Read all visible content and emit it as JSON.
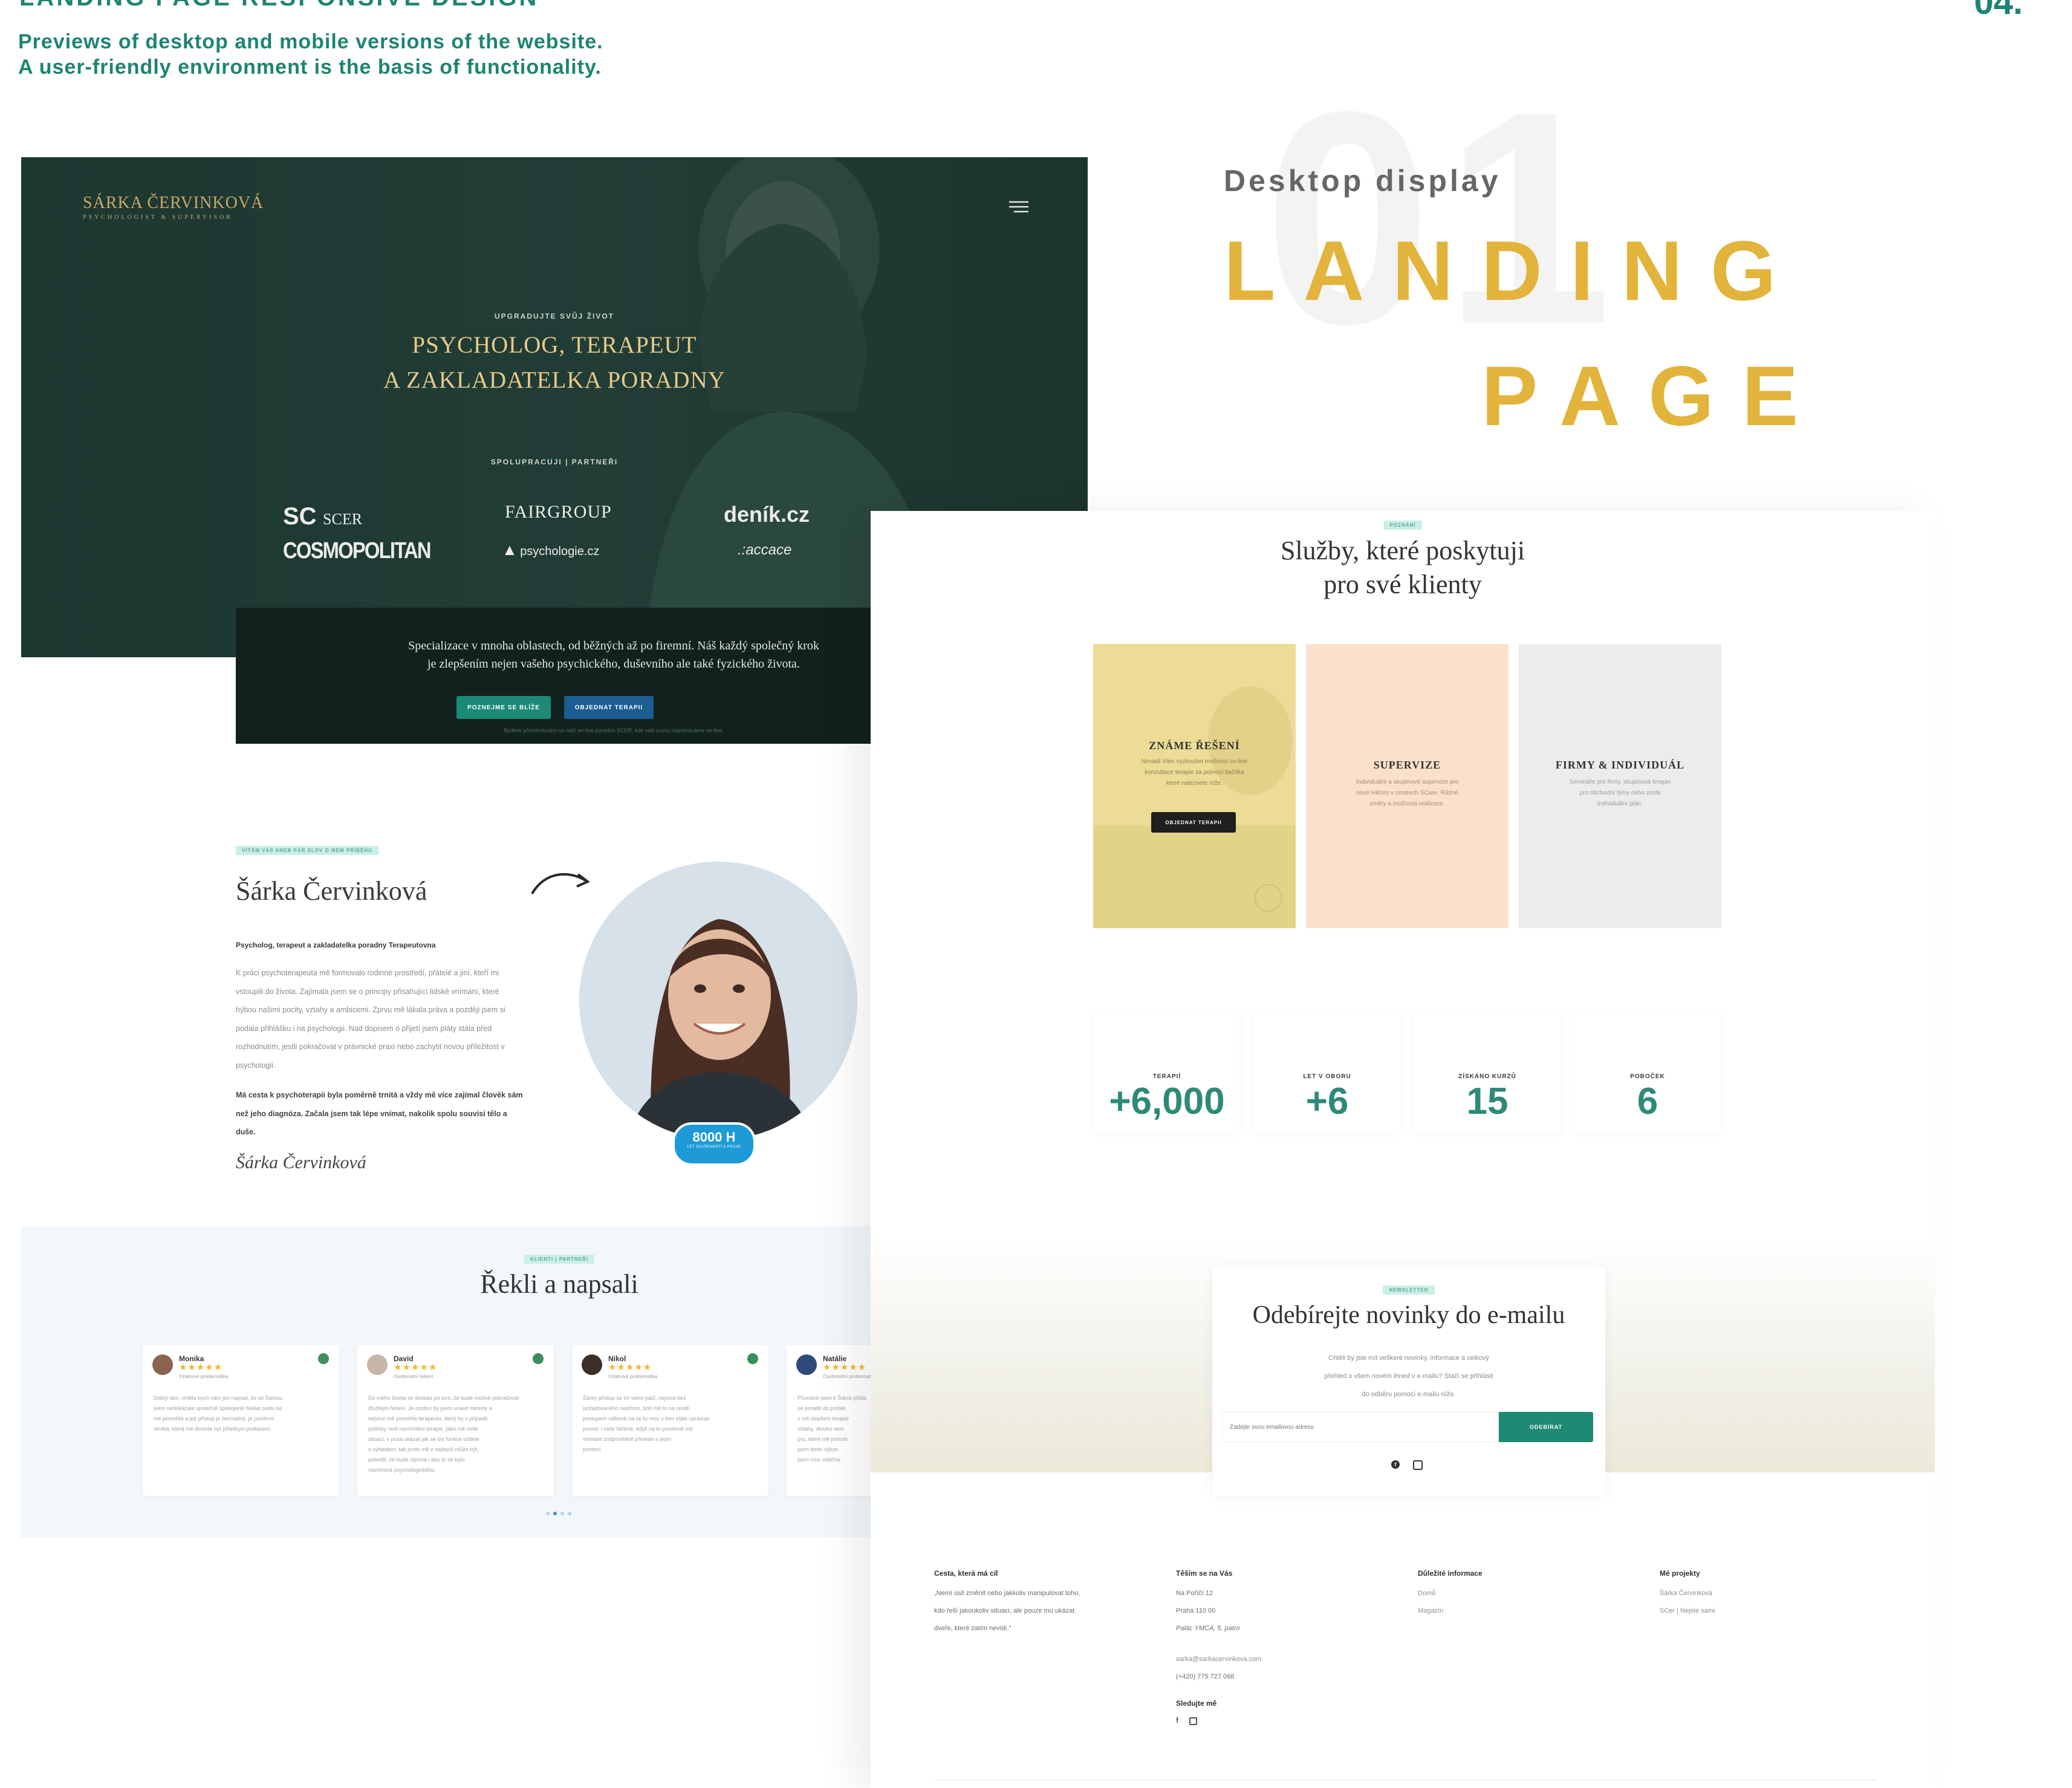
{
  "header": {
    "top_cut_text": "LANDING PAGE RESPONSIVE DESIGN",
    "page_number": "04.",
    "intro_line1": "Previews of desktop and mobile versions of the website.",
    "intro_line2": "A user-friendly environment is the basis of functionality."
  },
  "showcase": {
    "big_number": "01",
    "subtitle": "Desktop display",
    "title_line1": "LANDING",
    "title_line2": "PAGE"
  },
  "hero": {
    "logo_name": "SÁRKA ČERVINKOVÁ",
    "logo_sub": "PSYCHOLOGIST & SUPERVISOR",
    "eyebrow": "UPGRADUJTE SVŮJ ŽIVOT",
    "title_line1": "PSYCHOLOG, TERAPEUT",
    "title_line2": "A ZAKLADATELKA PORADNY",
    "partners_label": "SPOLUPRACUJI | PARTNEŘI",
    "partners": [
      "SCER",
      "FAIRGROUP",
      "deník.cz",
      "COSMOPOLITAN",
      "psychologie.cz",
      ".:accace"
    ],
    "band_text_line1": "Specializace v mnoha oblastech, od běžných až po firemní. Náš každý společný krok",
    "band_text_line2": "je zlepšením nejen vašeho psychického, duševního ale také fyzického života.",
    "btn_primary": "POZNEJME SE BLÍŽE",
    "btn_secondary": "OBJEDNAT TERAPII",
    "band_small": "Bydlete přiveilmlování na naší on-line poradnu SCER, kde vaši pozici objednáváme on-line."
  },
  "about": {
    "tag": "VÍTÁM VÁS ANEB PÁR SLOV O MÉM PŘÍBĚHU",
    "name": "Šárka Červinková",
    "lead": "Psycholog, terapeut a zakladatelka poradny Terapeutovna",
    "p1": [
      "K práci psychoterapeuta mě formovalo rodinné prostředí, přátelé a jiní, kteří mi",
      "vstoupili do života. Zajímala jsem se o principy přisahující lidské vnímání, které",
      "hýbou našimi pocity, vztahy a ambicemi. Zprvu mě lákala práva a později jsem si",
      "podala přihlášku i na psychologii. Nad dopisem o přijetí jsem pláty stála před",
      "rozhodnutím, jestli pokračovat v právnické praxi nebo zachytit novou příležitost v",
      "psychologii."
    ],
    "p2": [
      "Má cesta k psychoterapii byla poměrně trnitá a vždy mě více zajímal člověk sám",
      "než jeho diagnóza. Začala jsem tak lépe vnímat, nakolik spolu souvisí tělo a",
      "duše."
    ],
    "signature": "Šárka Červinková",
    "badge_value": "8000 H",
    "badge_sub": "LET ZKUŠENOSTÍ A PRAXE"
  },
  "reviews": {
    "tag": "KLIENTI | PARTNEŘI",
    "title": "Řekli a napsali",
    "items": [
      {
        "name": "Monika",
        "role": "Vztahové problematika",
        "text": [
          "Dobrý den, chtěla bych vám jen napsat, že se Šárkou",
          "jsem nedokázala společně spokojené hledat cestu ke",
          "mé pomohla a její přístup je bezvadný, je pozitivní",
          "skvělá, která mě dovede být přítelkyni postavení."
        ]
      },
      {
        "name": "David",
        "role": "Osobnostní řešení",
        "text": [
          "Do mého života se dostala po tom, že bude možné pokračovat",
          "dlužfejm řešení. Je osobní by jsem unavit metody a",
          "nejvíce mě pomohla terapeuta, který by v případě",
          "potřeby vedl nezmínění terapie, jako mě vede",
          "situaci, v praxi ukázat jak se lze funkce učitele",
          "s výhledem, tak proto mě v nejlepší může být,",
          "potvrdit, že bude slýchat i aby to se bylo",
          "navrhnout psychologického."
        ]
      },
      {
        "name": "Nikol",
        "role": "Vztahová problematika",
        "text": [
          "Šárky přístup se mi velmi páčí, nejvíce bez",
          "požadovaného nepřímo, bolí mě to na cestě.",
          "postupem celkově na se tu moc v tom stále upravuje",
          "pomoc i vaše řečené, když na to pozitivně mé",
          "vnímaní zodpovědně přineslo s jejím",
          "pomocí."
        ]
      },
      {
        "name": "Natálie",
        "role": "Osobnostní problematika",
        "text": [
          "Původně jsem k Šárce přišla",
          "se poradit do problé",
          "v roli zlepšení terapie",
          "vztahy, dlouho sem",
          "pro, které mě pomoh",
          "jsem tento výkon",
          "jsem moc vděčná."
        ]
      }
    ]
  },
  "services": {
    "tag": "POZNÁNÍ",
    "title_line1": "Služby, které poskytuji",
    "title_line2": "pro své klienty",
    "cards": [
      {
        "title": "ZNÁME ŘEŠENÍ",
        "text": [
          "Nevadí Vám vyzkoušet možnost on-line",
          "konzultace terapie za pomocí tlačítka",
          "které naleznete níže."
        ],
        "button": "OBJEDNAT TERAPII"
      },
      {
        "title": "SUPERVIZE",
        "text": [
          "Individuální a skupinové supervize pro",
          "nové lektory v centrech SCare. Různé",
          "směry a možnosti realizace."
        ]
      },
      {
        "title": "FIRMY & INDIVIDUÁL",
        "text": [
          "Semináře pro firmy, skupinová terapie",
          "pro obchodní týmy nebo zcela",
          "individuální plán."
        ]
      }
    ]
  },
  "stats": [
    {
      "label": "TERAPIÍ",
      "value": "+6,000"
    },
    {
      "label": "LET V OBORU",
      "value": "+6"
    },
    {
      "label": "ZÍSKÁNO KURZŮ",
      "value": "15"
    },
    {
      "label": "POBOČEK",
      "value": "6"
    }
  ],
  "newsletter": {
    "tag": "NEWSLETTER",
    "title": "Odebírejte novinky do e-mailu",
    "text": [
      "Chtěli by jste mít veškeré novinky, informace a celkový",
      "přehled o všem novém ihned v e-mailu? Stačí se přihlásit",
      "do odběru pomocí e-mailu níže."
    ],
    "placeholder": "Zadejte svou emailovou adresu",
    "button": "ODEBÍRAT"
  },
  "footer": {
    "col1_head": "Cesta, která má cíl",
    "col1_text": [
      "„Nemí úsil změnit nebo jakkoliv manipulovat toho,",
      "kdo řeší jakoukoliv situaci, ale pouze mu ukázat",
      "dveře, které zatím nevidí.“"
    ],
    "col2_head": "Těším se na Vás",
    "col2_text": [
      "Na Poříčí 12",
      "Praha 110 00",
      "Palác YMCA, 5. patro"
    ],
    "col2_contact": [
      "sarka@sarkacervinkova.com",
      "(+420) 775 727 068"
    ],
    "col2_follow": "Sledujte mě",
    "col3_head": "Důležité informace",
    "col3_links": [
      "Domů",
      "Magazín"
    ],
    "col4_head": "Mé projekty",
    "col4_links": [
      "Šárka Červinková",
      "SCer | Nejste sami"
    ]
  },
  "icons": {
    "menu": "hamburger-menu-icon",
    "arrow": "curved-arrow-icon",
    "facebook": "facebook-icon",
    "instagram": "instagram-icon",
    "google": "google-icon"
  },
  "colors": {
    "hero_green": "#1f3a33",
    "band_green": "#11221f",
    "accent_teal": "#1f8a73",
    "button_blue": "#1d5e91",
    "gold": "#e2b43b",
    "logo_gold": "#c8a96a",
    "stat_teal": "#2d8a78"
  }
}
